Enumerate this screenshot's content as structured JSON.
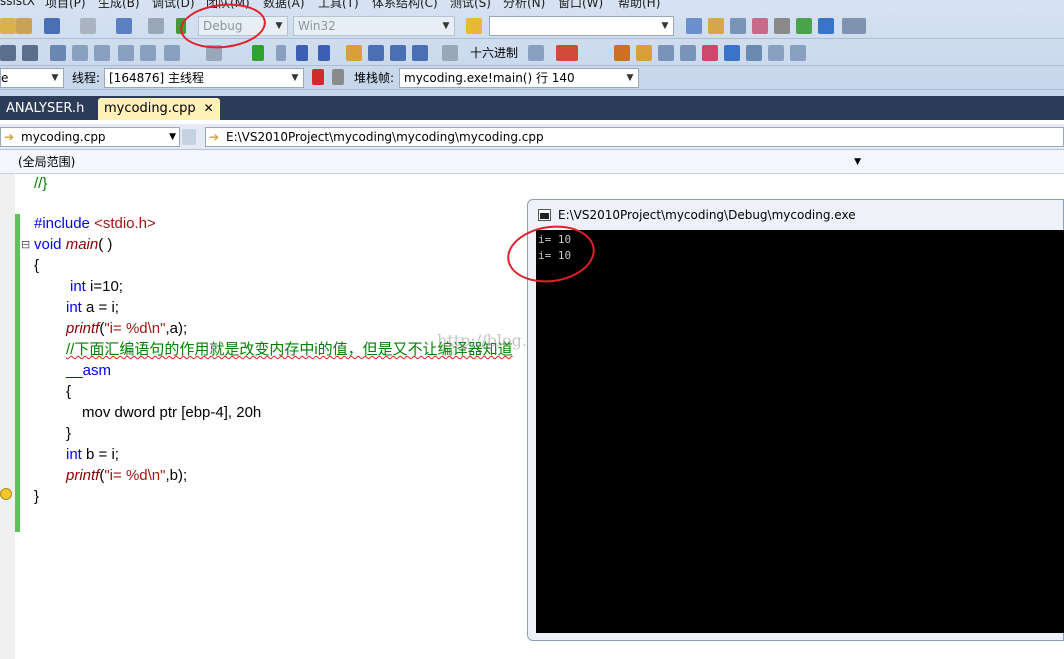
{
  "menu": [
    "ssistX",
    "项目(P)",
    "生成(B)",
    "调试(D)",
    "团队(M)",
    "数据(A)",
    "工具(T)",
    "体系结构(C)",
    "测试(S)",
    "分析(N)",
    "窗口(W)",
    "帮助(H)"
  ],
  "toolbar": {
    "config": "Debug",
    "platform": "Win32",
    "find_value": "",
    "hex_label": "十六进制"
  },
  "debug_bar": {
    "process_value": "e",
    "thread_label": "线程:",
    "thread_value": "[164876] 主线程",
    "stack_label": "堆栈帧:",
    "stack_value": "mycoding.exe!main()  行 140"
  },
  "tabs": [
    {
      "label": "ANALYSER.h"
    },
    {
      "label": "mycoding.cpp",
      "close": "✕"
    }
  ],
  "nav": {
    "file": "mycoding.cpp",
    "path": "E:\\VS2010Project\\mycoding\\mycoding\\mycoding.cpp",
    "scope": "(全局范围)"
  },
  "code": {
    "l0": "//}",
    "l1_pp": "#include",
    "l1_inc": "<stdio.h>",
    "l2_kw": "void",
    "l2_fn": "main",
    "l2_rest": "( )",
    "l3": "{",
    "l4_kw": "int",
    "l4_rest": " i=10;",
    "l5_kw": "int",
    "l5_rest": " a = i;",
    "l6_fn": "printf",
    "l6_a": "(",
    "l6_str": "\"i= %d\\n\"",
    "l6_b": ",a);",
    "l7": "//下面汇编语句的作用就是改变内存中i的值，但是又不让编译器知道",
    "l8_kw": "__asm",
    "l9": "{",
    "l10": "mov dword ptr [ebp-4], 20h",
    "l11": "}",
    "l12_kw": "int",
    "l12_rest": " b = i;",
    "l13_fn": "printf",
    "l13_a": "(",
    "l13_str": "\"i= %d\\n\"",
    "l13_b": ",b);",
    "l14": "}"
  },
  "console": {
    "title": "E:\\VS2010Project\\mycoding\\Debug\\mycoding.exe",
    "lines": [
      "i= 10",
      "i= 10"
    ]
  },
  "watermark": "http://blog.csdn.net/",
  "colors": {
    "keyword": "#0000ff",
    "string": "#a31515",
    "comment": "#008000",
    "annotation": "#e0202a",
    "tab_active": "#fff1b8",
    "tabstrip": "#2b3c59"
  }
}
